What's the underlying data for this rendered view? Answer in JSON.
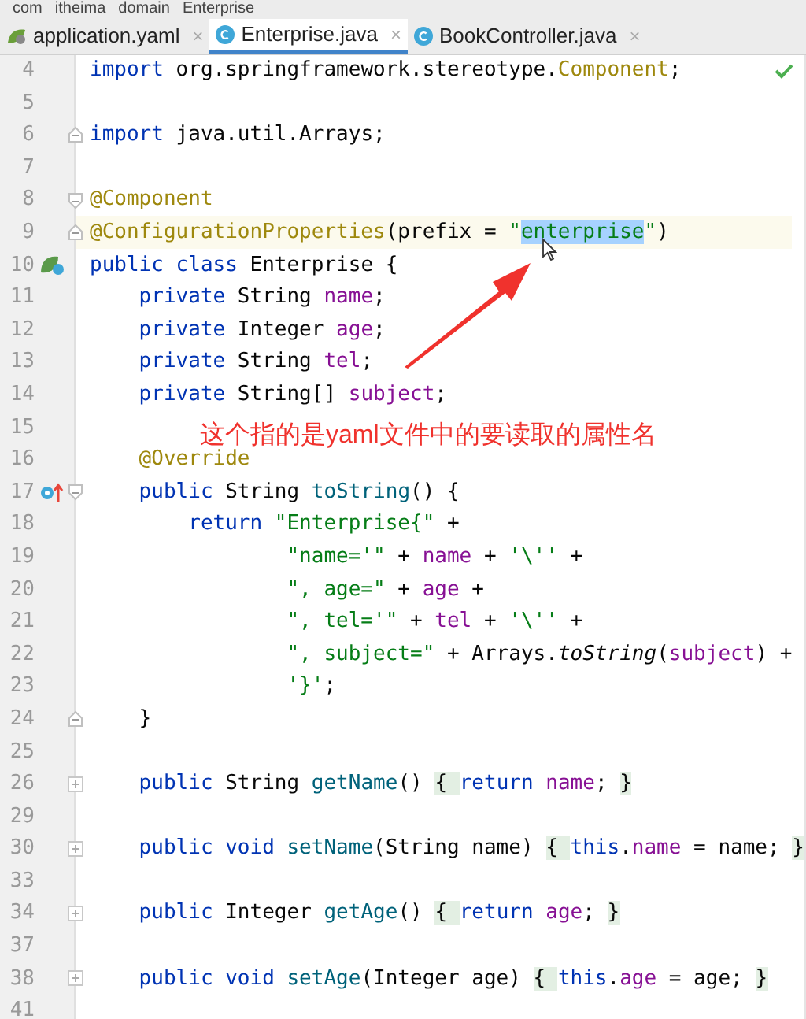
{
  "breadcrumb": [
    "com",
    "itheima",
    "domain",
    "Enterprise"
  ],
  "tabs": [
    {
      "label": "application.yaml",
      "kind": "yaml",
      "selected": false,
      "close": "×"
    },
    {
      "label": "Enterprise.java",
      "kind": "class",
      "selected": true,
      "close": "×"
    },
    {
      "label": "BookController.java",
      "kind": "class",
      "selected": false,
      "close": "×"
    }
  ],
  "editor": {
    "lines": [
      {
        "number": "4",
        "current": false,
        "tokens": [
          {
            "kind": "keyword",
            "text": "import"
          },
          {
            "kind": "plain",
            "text": " org.springframework.stereotype."
          },
          {
            "kind": "annotation",
            "text": "Component"
          },
          {
            "kind": "plain",
            "text": ";"
          }
        ]
      },
      {
        "number": "5",
        "current": false
      },
      {
        "number": "6",
        "current": false,
        "fold_marker": {
          "kind": "end"
        },
        "tokens": [
          {
            "kind": "keyword",
            "text": "import"
          },
          {
            "kind": "plain",
            "text": " java.util.Arrays;"
          }
        ]
      },
      {
        "number": "7",
        "current": false
      },
      {
        "number": "8",
        "current": false,
        "fold_marker": {
          "kind": "start"
        },
        "tokens": [
          {
            "kind": "annotation",
            "text": "@Component"
          }
        ]
      },
      {
        "number": "9",
        "current": true,
        "fold_marker": {
          "kind": "end"
        },
        "tokens": [
          {
            "kind": "annotation",
            "text": "@ConfigurationProperties"
          },
          {
            "kind": "plain",
            "text": "(prefix = "
          },
          {
            "kind": "string",
            "text": "\""
          },
          {
            "kind": "selection",
            "text": "enterprise"
          },
          {
            "kind": "string",
            "text": "\""
          },
          {
            "kind": "plain",
            "text": ")"
          }
        ]
      },
      {
        "number": "10",
        "current": false,
        "gutter_icon": {
          "kind": "bean"
        },
        "tokens": [
          {
            "kind": "keyword",
            "text": "public class"
          },
          {
            "kind": "plain",
            "text": " Enterprise {"
          }
        ]
      },
      {
        "number": "11",
        "current": false,
        "tokens": [
          {
            "kind": "keyword",
            "text": "    private"
          },
          {
            "kind": "plain",
            "text": " String "
          },
          {
            "kind": "field",
            "text": "name"
          },
          {
            "kind": "plain",
            "text": ";"
          }
        ]
      },
      {
        "number": "12",
        "current": false,
        "tokens": [
          {
            "kind": "keyword",
            "text": "    private"
          },
          {
            "kind": "plain",
            "text": " Integer "
          },
          {
            "kind": "field",
            "text": "age"
          },
          {
            "kind": "plain",
            "text": ";"
          }
        ]
      },
      {
        "number": "13",
        "current": false,
        "tokens": [
          {
            "kind": "keyword",
            "text": "    private"
          },
          {
            "kind": "plain",
            "text": " String "
          },
          {
            "kind": "field",
            "text": "tel"
          },
          {
            "kind": "plain",
            "text": ";"
          }
        ]
      },
      {
        "number": "14",
        "current": false,
        "tokens": [
          {
            "kind": "keyword",
            "text": "    private"
          },
          {
            "kind": "plain",
            "text": " String[] "
          },
          {
            "kind": "field",
            "text": "subject"
          },
          {
            "kind": "plain",
            "text": ";"
          }
        ]
      },
      {
        "number": "15",
        "current": false
      },
      {
        "number": "16",
        "current": false,
        "tokens": [
          {
            "kind": "annotation",
            "text": "    @Override"
          }
        ]
      },
      {
        "number": "17",
        "current": false,
        "gutter_icon": {
          "kind": "override"
        },
        "fold_marker": {
          "kind": "start"
        },
        "tokens": [
          {
            "kind": "keyword",
            "text": "    public"
          },
          {
            "kind": "plain",
            "text": " String "
          },
          {
            "kind": "method",
            "text": "toString"
          },
          {
            "kind": "plain",
            "text": "() {"
          }
        ]
      },
      {
        "number": "18",
        "current": false,
        "tokens": [
          {
            "kind": "keyword",
            "text": "        return "
          },
          {
            "kind": "string",
            "text": "\"Enterprise{\""
          },
          {
            "kind": "plain",
            "text": " +"
          }
        ]
      },
      {
        "number": "19",
        "current": false,
        "tokens": [
          {
            "kind": "string",
            "text": "                \"name='\""
          },
          {
            "kind": "plain",
            "text": " + "
          },
          {
            "kind": "field",
            "text": "name"
          },
          {
            "kind": "plain",
            "text": " + "
          },
          {
            "kind": "string",
            "text": "'\\''"
          },
          {
            "kind": "plain",
            "text": " +"
          }
        ]
      },
      {
        "number": "20",
        "current": false,
        "tokens": [
          {
            "kind": "string",
            "text": "                \", age=\""
          },
          {
            "kind": "plain",
            "text": " + "
          },
          {
            "kind": "field",
            "text": "age"
          },
          {
            "kind": "plain",
            "text": " +"
          }
        ]
      },
      {
        "number": "21",
        "current": false,
        "tokens": [
          {
            "kind": "string",
            "text": "                \", tel='\""
          },
          {
            "kind": "plain",
            "text": " + "
          },
          {
            "kind": "field",
            "text": "tel"
          },
          {
            "kind": "plain",
            "text": " + "
          },
          {
            "kind": "string",
            "text": "'\\''"
          },
          {
            "kind": "plain",
            "text": " +"
          }
        ]
      },
      {
        "number": "22",
        "current": false,
        "tokens": [
          {
            "kind": "string",
            "text": "                \", subject=\""
          },
          {
            "kind": "plain",
            "text": " + Arrays."
          },
          {
            "kind": "static",
            "text": "toString"
          },
          {
            "kind": "plain",
            "text": "("
          },
          {
            "kind": "field",
            "text": "subject"
          },
          {
            "kind": "plain",
            "text": ") +"
          }
        ]
      },
      {
        "number": "23",
        "current": false,
        "tokens": [
          {
            "kind": "string",
            "text": "                '}'"
          },
          {
            "kind": "plain",
            "text": ";"
          }
        ]
      },
      {
        "number": "24",
        "current": false,
        "fold_marker": {
          "kind": "end"
        },
        "tokens": [
          {
            "kind": "plain",
            "text": "    }"
          }
        ]
      },
      {
        "number": "25",
        "current": false
      },
      {
        "number": "26",
        "current": false,
        "fold_marker": {
          "kind": "collapsed"
        },
        "tokens": [
          {
            "kind": "keyword",
            "text": "    public"
          },
          {
            "kind": "plain",
            "text": " String "
          },
          {
            "kind": "method",
            "text": "getName"
          },
          {
            "kind": "plain",
            "text": "() "
          },
          {
            "kind": "folded",
            "text": "{ "
          },
          {
            "kind": "keyword",
            "text": "return "
          },
          {
            "kind": "field",
            "text": "name"
          },
          {
            "kind": "plain",
            "text": "; "
          },
          {
            "kind": "folded",
            "text": "}"
          }
        ]
      },
      {
        "number": "29",
        "current": false
      },
      {
        "number": "30",
        "current": false,
        "fold_marker": {
          "kind": "collapsed"
        },
        "tokens": [
          {
            "kind": "keyword",
            "text": "    public void "
          },
          {
            "kind": "method",
            "text": "setName"
          },
          {
            "kind": "plain",
            "text": "(String name) "
          },
          {
            "kind": "folded",
            "text": "{ "
          },
          {
            "kind": "keyword",
            "text": "this"
          },
          {
            "kind": "plain",
            "text": "."
          },
          {
            "kind": "field",
            "text": "name"
          },
          {
            "kind": "plain",
            "text": " = name; "
          },
          {
            "kind": "folded",
            "text": "}"
          }
        ]
      },
      {
        "number": "33",
        "current": false
      },
      {
        "number": "34",
        "current": false,
        "fold_marker": {
          "kind": "collapsed"
        },
        "tokens": [
          {
            "kind": "keyword",
            "text": "    public"
          },
          {
            "kind": "plain",
            "text": " Integer "
          },
          {
            "kind": "method",
            "text": "getAge"
          },
          {
            "kind": "plain",
            "text": "() "
          },
          {
            "kind": "folded",
            "text": "{ "
          },
          {
            "kind": "keyword",
            "text": "return "
          },
          {
            "kind": "field",
            "text": "age"
          },
          {
            "kind": "plain",
            "text": "; "
          },
          {
            "kind": "folded",
            "text": "}"
          }
        ]
      },
      {
        "number": "37",
        "current": false
      },
      {
        "number": "38",
        "current": false,
        "fold_marker": {
          "kind": "collapsed"
        },
        "tokens": [
          {
            "kind": "keyword",
            "text": "    public void "
          },
          {
            "kind": "method",
            "text": "setAge"
          },
          {
            "kind": "plain",
            "text": "(Integer age) "
          },
          {
            "kind": "folded",
            "text": "{ "
          },
          {
            "kind": "keyword",
            "text": "this"
          },
          {
            "kind": "plain",
            "text": "."
          },
          {
            "kind": "field",
            "text": "age"
          },
          {
            "kind": "plain",
            "text": " = age; "
          },
          {
            "kind": "folded",
            "text": "}"
          }
        ]
      },
      {
        "number": "41",
        "current": false
      }
    ]
  },
  "annotation_note": "这个指的是yaml文件中的要读取的属性名"
}
